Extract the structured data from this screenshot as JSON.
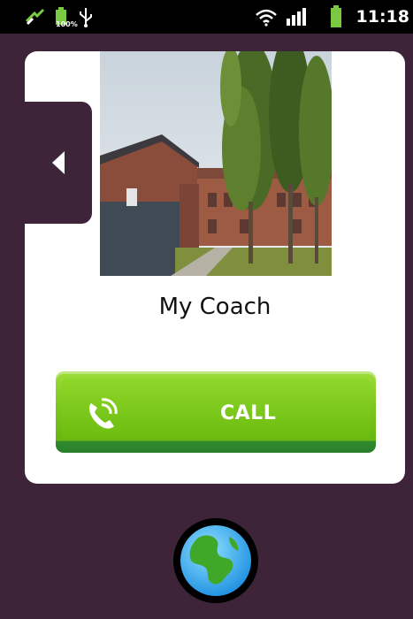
{
  "status_bar": {
    "battery_percent": "100%",
    "time": "11:18",
    "icons": [
      "usb-tethering-icon",
      "battery-small-icon",
      "usb-icon",
      "wifi-icon",
      "signal-icon",
      "battery-icon"
    ]
  },
  "contact": {
    "name": "My Coach",
    "photo": "building-photo"
  },
  "call_button": {
    "label": "CALL",
    "icon": "phone-call-icon"
  },
  "nav": {
    "back_icon": "back-arrow-icon",
    "globe_icon": "globe-icon"
  },
  "colors": {
    "background": "#3e2438",
    "card": "#ffffff",
    "call_green": "#7cc61d"
  }
}
